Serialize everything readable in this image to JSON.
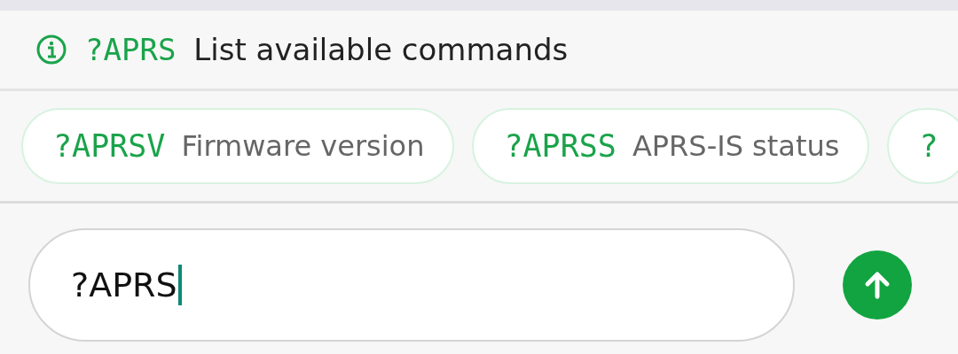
{
  "hint": {
    "command": "?APRS",
    "description": "List available commands"
  },
  "suggestions": [
    {
      "command": "?APRSV",
      "description": "Firmware version"
    },
    {
      "command": "?APRSS",
      "description": "APRS-IS status"
    },
    {
      "command": "?"
    }
  ],
  "input": {
    "value": "?APRS"
  }
}
